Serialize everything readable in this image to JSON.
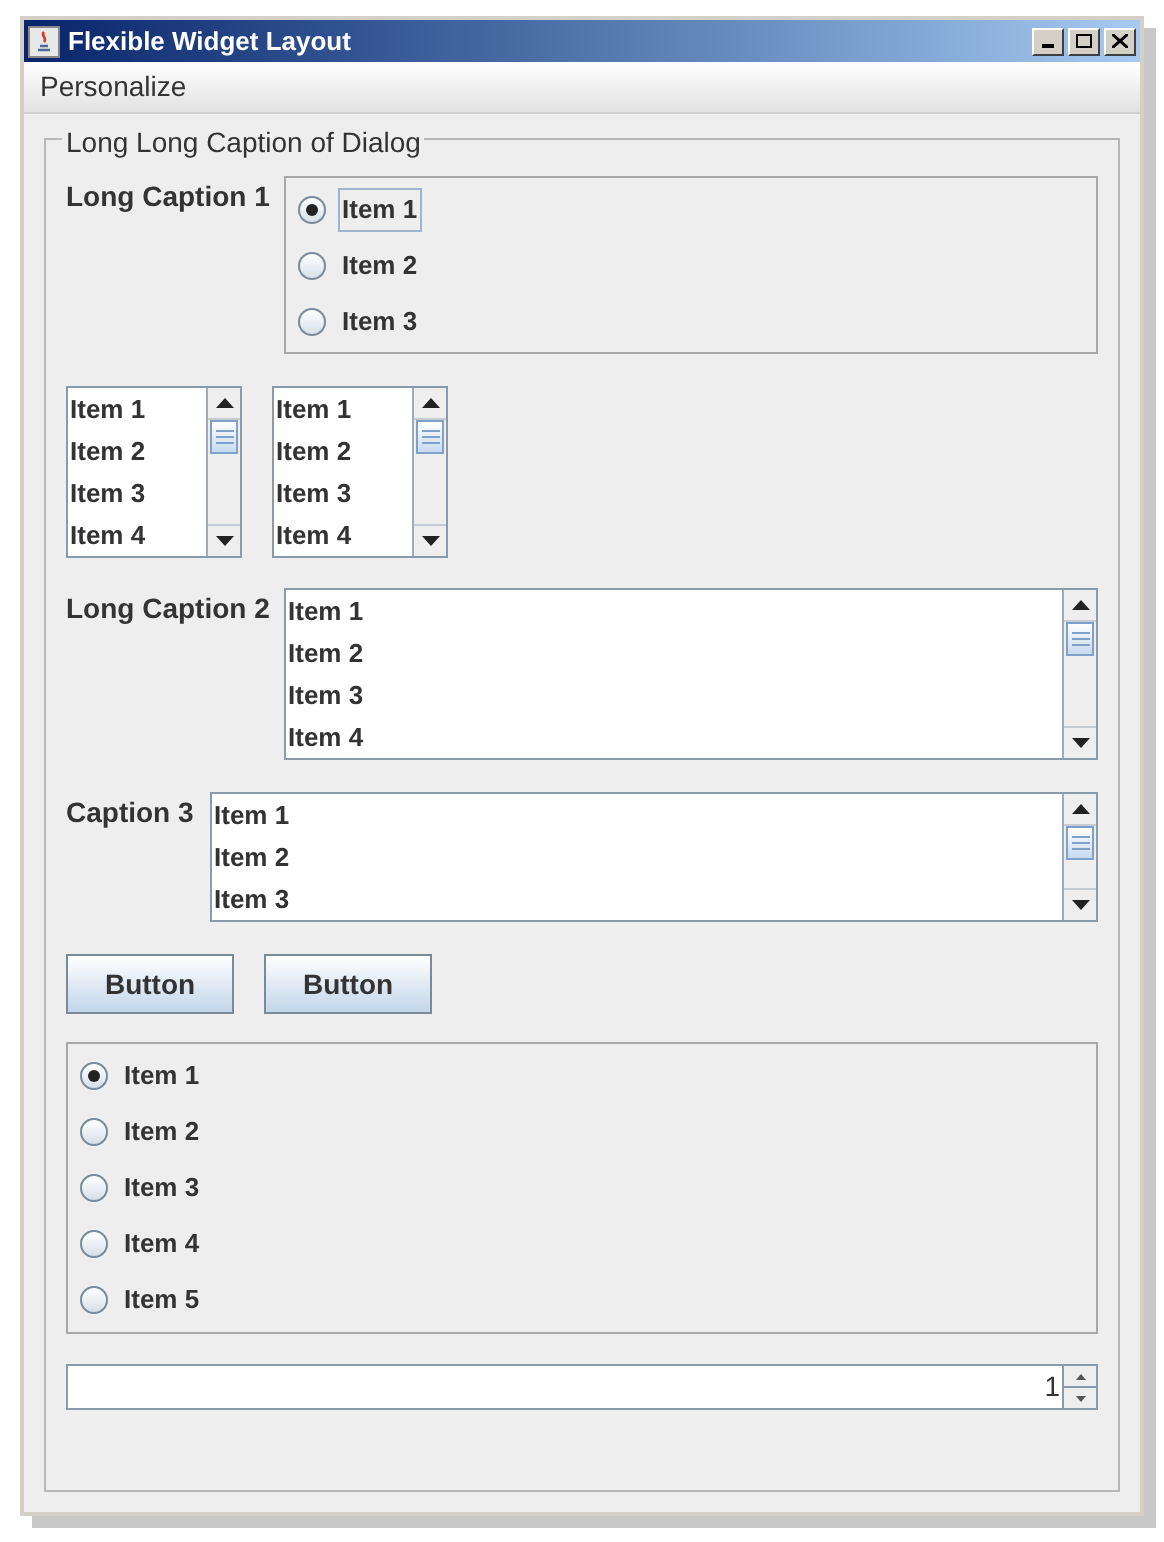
{
  "window": {
    "title": "Flexible Widget Layout"
  },
  "menu": [
    "Personalize"
  ],
  "group": {
    "caption": "Long Long Caption of Dialog"
  },
  "radio_group_1": {
    "caption": "Long Caption 1",
    "items": [
      {
        "label": "Item 1",
        "selected": true,
        "focused": true
      },
      {
        "label": "Item 2",
        "selected": false,
        "focused": false
      },
      {
        "label": "Item 3",
        "selected": false,
        "focused": false
      }
    ]
  },
  "small_lists": [
    {
      "items": [
        "Item 1",
        "Item 2",
        "Item 3",
        "Item 4"
      ]
    },
    {
      "items": [
        "Item 1",
        "Item 2",
        "Item 3",
        "Item 4"
      ]
    }
  ],
  "list_2": {
    "caption": "Long Caption 2",
    "items": [
      "Item 1",
      "Item 2",
      "Item 3",
      "Item 4"
    ]
  },
  "list_3": {
    "caption": "Caption 3",
    "items": [
      "Item 1",
      "Item 2",
      "Item 3"
    ]
  },
  "buttons": [
    "Button",
    "Button"
  ],
  "radio_group_2": {
    "items": [
      {
        "label": "Item 1",
        "selected": true
      },
      {
        "label": "Item 2",
        "selected": false
      },
      {
        "label": "Item 3",
        "selected": false
      },
      {
        "label": "Item 4",
        "selected": false
      },
      {
        "label": "Item 5",
        "selected": false
      }
    ]
  },
  "spinner": {
    "value": "1"
  }
}
